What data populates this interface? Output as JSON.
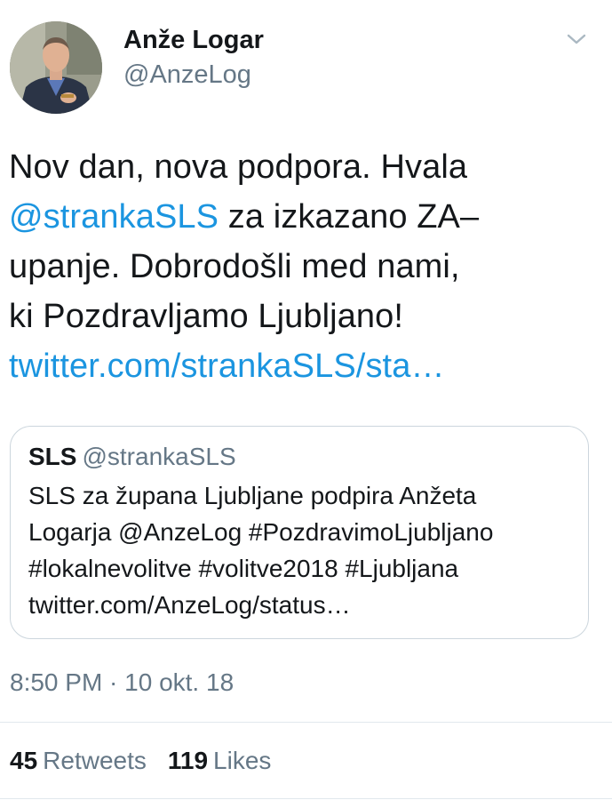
{
  "author": {
    "display_name": "Anže Logar",
    "handle": "@AnzeLog"
  },
  "tweet": {
    "lines": [
      [
        {
          "text": "Nov dan, nova podpora. Hvala",
          "link": false
        }
      ],
      [
        {
          "text": "@strankaSLS",
          "link": true
        },
        {
          "text": " za izkazano ZA–",
          "link": false
        }
      ],
      [
        {
          "text": "upanje. Dobrodošli med nami,",
          "link": false
        }
      ],
      [
        {
          "text": "ki Pozdravljamo Ljubljano!",
          "link": false
        }
      ],
      [
        {
          "text": "twitter.com/strankaSLS/sta…",
          "link": true
        }
      ]
    ]
  },
  "quoted_tweet": {
    "name": "SLS",
    "handle": "@strankaSLS",
    "lines": [
      "SLS za župana Ljubljane podpira Anžeta",
      "Logarja @AnzeLog #PozdravimoLjubljano",
      "#lokalnevolitve #volitve2018 #Ljubljana",
      "twitter.com/AnzeLog/status…"
    ]
  },
  "timestamp": "8:50 PM · 10 okt. 18",
  "stats": {
    "retweets_count": "45",
    "retweets_label": "Retweets",
    "likes_count": "119",
    "likes_label": "Likes"
  },
  "colors": {
    "text": "#14171a",
    "secondary": "#657786",
    "link": "#1b95e0",
    "border": "#ccd6dd",
    "divider": "#e1e8ed"
  },
  "icons": {
    "menu": "chevron-down-icon"
  }
}
